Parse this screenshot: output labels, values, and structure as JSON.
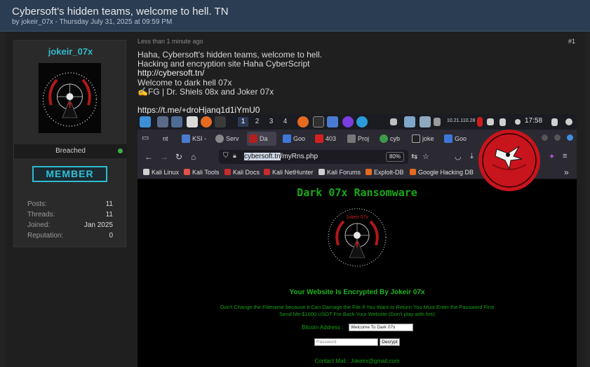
{
  "thread": {
    "title": "Cybersoft's hidden teams, welcome to hell. TN",
    "meta": "by jokeir_07x - Thursday July 31, 2025 at 09:59 PM"
  },
  "user": {
    "name": "jokeir_07x",
    "status": "Breached",
    "rank": "MEMBER",
    "stats": [
      {
        "label": "Posts:",
        "value": "11"
      },
      {
        "label": "Threads:",
        "value": "11"
      },
      {
        "label": "Joined:",
        "value": "Jan 2025"
      },
      {
        "label": "Reputation:",
        "value": "0"
      }
    ]
  },
  "post": {
    "time": "Less than 1 minute ago",
    "number": "#1",
    "lines": [
      "Haha, Cybersoft's hidden teams, welcome to hell.",
      "Hacking and encryption site Haha CyberScript",
      "http://cybersoft.tn/",
      "Welcome to dark hell 07x",
      "✍️FG | Dr. Shiels 08x and Joker 07x",
      "https://t.me/+droHjanq1d1iYmU0"
    ]
  },
  "screenshot": {
    "taskbar": {
      "workspaces": [
        "1",
        "2",
        "3",
        "4"
      ],
      "ip": "10.21.110.28",
      "clock": "17:58"
    },
    "tabs": [
      "nt",
      "KSI -",
      "Serv",
      "Da",
      "Goo",
      "403",
      "Proj",
      "cyb",
      "joke",
      "Goo"
    ],
    "url_host": "cybersoft.tn",
    "url_path": "/myRns.php",
    "zoom": "80%",
    "bookmarks": [
      "Kali Linux",
      "Kali Tools",
      "Kali Docs",
      "Kali NetHunter",
      "Kali Forums",
      "Exploit-DB",
      "Google Hacking DB"
    ],
    "page": {
      "title": "Dark 07x Ransomware",
      "logo_text": "Jokeir 07x",
      "subtitle": "Your Website Is Encrypted By Jokeir 07x",
      "warning_1": "Don't Change the Filename because it Can Damage the File if You Want to Return You Must Enter the Password First",
      "warning_2": "Send Me $1000 USDT For Back Your Website (Don't play with fire)",
      "bitcoin_label": "Bitcoin Address :",
      "bitcoin_value": "Welcome To Dark 07x",
      "password_placeholder": "Password",
      "decrypt_label": "Decrypt",
      "contact": "Contact Mail : Jokeirx@gmail.com"
    }
  },
  "colors": {
    "header_bg": "#2b3d52",
    "username": "#33b9c9",
    "ransom_green": "#18a818",
    "stamp_red": "#c8141c"
  }
}
